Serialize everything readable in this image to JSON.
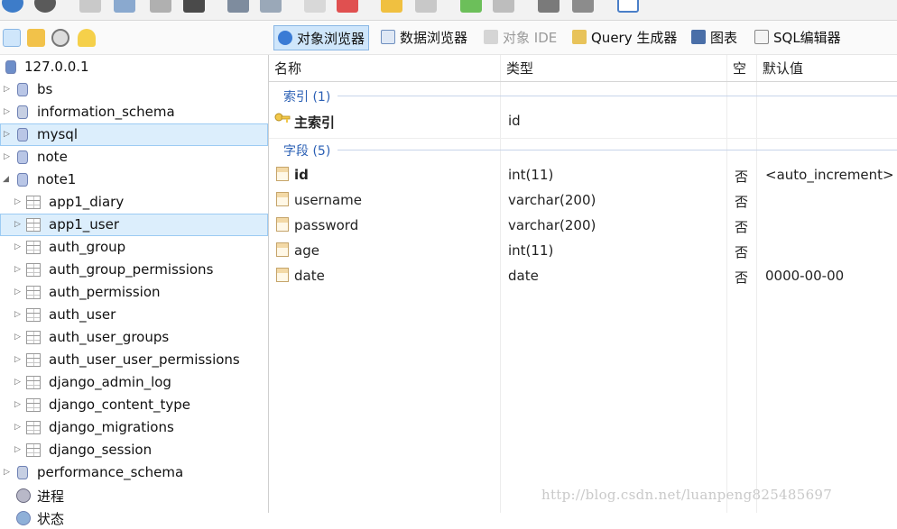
{
  "toolbar": {
    "icons": [
      "refresh-icon",
      "stop-icon",
      "scissors-icon",
      "copy-icon",
      "paste-icon",
      "delete-icon",
      "import-icon",
      "export-icon",
      "table-add-icon",
      "table-delete-icon",
      "key-add-icon",
      "key-edit-icon",
      "grid-add-icon",
      "grid-remove-icon",
      "link-add-icon",
      "link-edit-icon",
      "checklist-icon"
    ]
  },
  "left_header": {
    "icons": [
      "tree-icon",
      "filter-icon",
      "history-icon",
      "favorites-icon"
    ]
  },
  "tabs": [
    {
      "label": "对象浏览器",
      "active": true,
      "disabled": false,
      "icon": "object-browser-icon"
    },
    {
      "label": "数据浏览器",
      "active": false,
      "disabled": false,
      "icon": "data-browser-icon"
    },
    {
      "label": "对象 IDE",
      "active": false,
      "disabled": true,
      "icon": "object-ide-icon"
    },
    {
      "label": "Query 生成器",
      "active": false,
      "disabled": false,
      "icon": "query-builder-icon"
    },
    {
      "label": "图表",
      "active": false,
      "disabled": false,
      "icon": "chart-icon"
    },
    {
      "label": "SQL编辑器",
      "active": false,
      "disabled": false,
      "icon": "sql-editor-icon"
    }
  ],
  "tree": {
    "server": "127.0.0.1",
    "items": [
      {
        "label": "bs",
        "type": "db"
      },
      {
        "label": "information_schema",
        "type": "sysdb"
      },
      {
        "label": "mysql",
        "type": "db",
        "selected": true
      },
      {
        "label": "note",
        "type": "db"
      },
      {
        "label": "note1",
        "type": "db",
        "expanded": true
      }
    ],
    "note1_tables": [
      "app1_diary",
      "app1_user",
      "auth_group",
      "auth_group_permissions",
      "auth_permission",
      "auth_user",
      "auth_user_groups",
      "auth_user_user_permissions",
      "django_admin_log",
      "django_content_type",
      "django_migrations",
      "django_session"
    ],
    "selected_table": "app1_user",
    "after": [
      {
        "label": "performance_schema",
        "type": "sysdb"
      },
      {
        "label": "进程",
        "type": "process"
      },
      {
        "label": "状态",
        "type": "status"
      }
    ]
  },
  "grid": {
    "columns": [
      "名称",
      "类型",
      "空",
      "默认值"
    ],
    "index_section": "索引 (1)",
    "index_rows": [
      {
        "name": "主索引",
        "type": "id"
      }
    ],
    "field_section": "字段 (5)",
    "field_rows": [
      {
        "name": "id",
        "type": "int(11)",
        "null": "否",
        "default": "<auto_increment>",
        "bold": true
      },
      {
        "name": "username",
        "type": "varchar(200)",
        "null": "否",
        "default": ""
      },
      {
        "name": "password",
        "type": "varchar(200)",
        "null": "否",
        "default": ""
      },
      {
        "name": "age",
        "type": "int(11)",
        "null": "否",
        "default": ""
      },
      {
        "name": "date",
        "type": "date",
        "null": "否",
        "default": "0000-00-00"
      }
    ]
  },
  "watermark": "http://blog.csdn.net/luanpeng825485697",
  "colors": {
    "tab_active_bg": "#cfe6fb",
    "selection_bg": "#dceefc",
    "section_text": "#2a5fb4"
  }
}
